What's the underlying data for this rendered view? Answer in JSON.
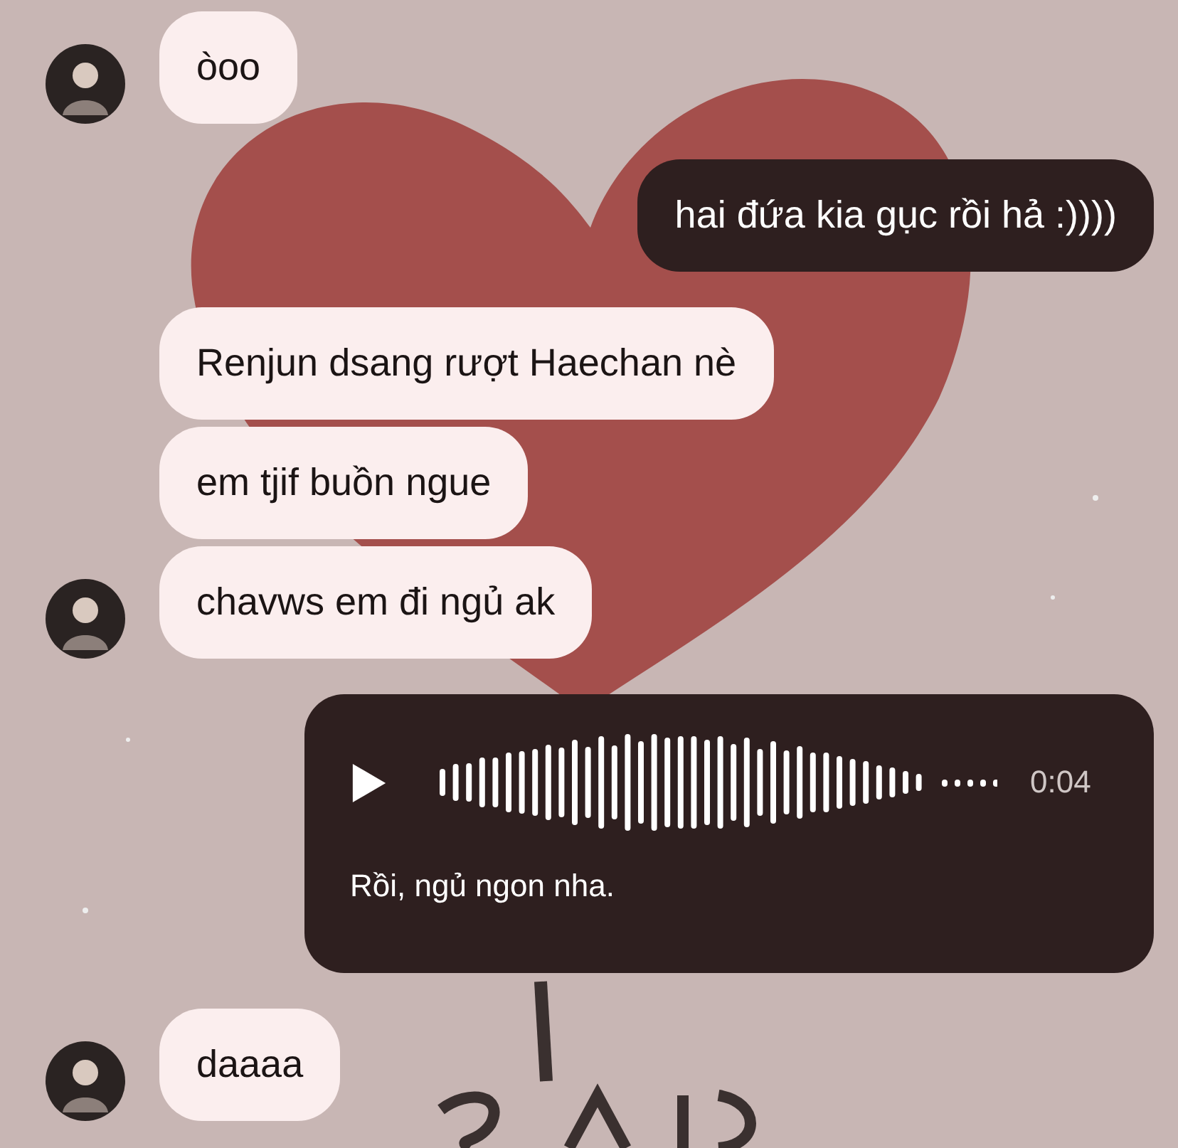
{
  "messages": [
    {
      "kind": "text",
      "outgoing": false,
      "avatar": true,
      "text": "òoo"
    },
    {
      "kind": "text",
      "outgoing": true,
      "text": "hai đứa kia gục rồi hả :))))"
    },
    {
      "kind": "text",
      "outgoing": false,
      "avatar": false,
      "text": "Renjun dsang rượt Haechan nè"
    },
    {
      "kind": "text",
      "outgoing": false,
      "avatar": false,
      "text": "em tjif buồn ngue"
    },
    {
      "kind": "text",
      "outgoing": false,
      "avatar": true,
      "text": "chavws em đi ngủ ak"
    },
    {
      "kind": "voice",
      "outgoing": true,
      "duration": "0:04",
      "transcript": "Rồi, ngủ ngon nha."
    },
    {
      "kind": "text",
      "outgoing": false,
      "avatar": true,
      "text": "daaaa"
    }
  ]
}
